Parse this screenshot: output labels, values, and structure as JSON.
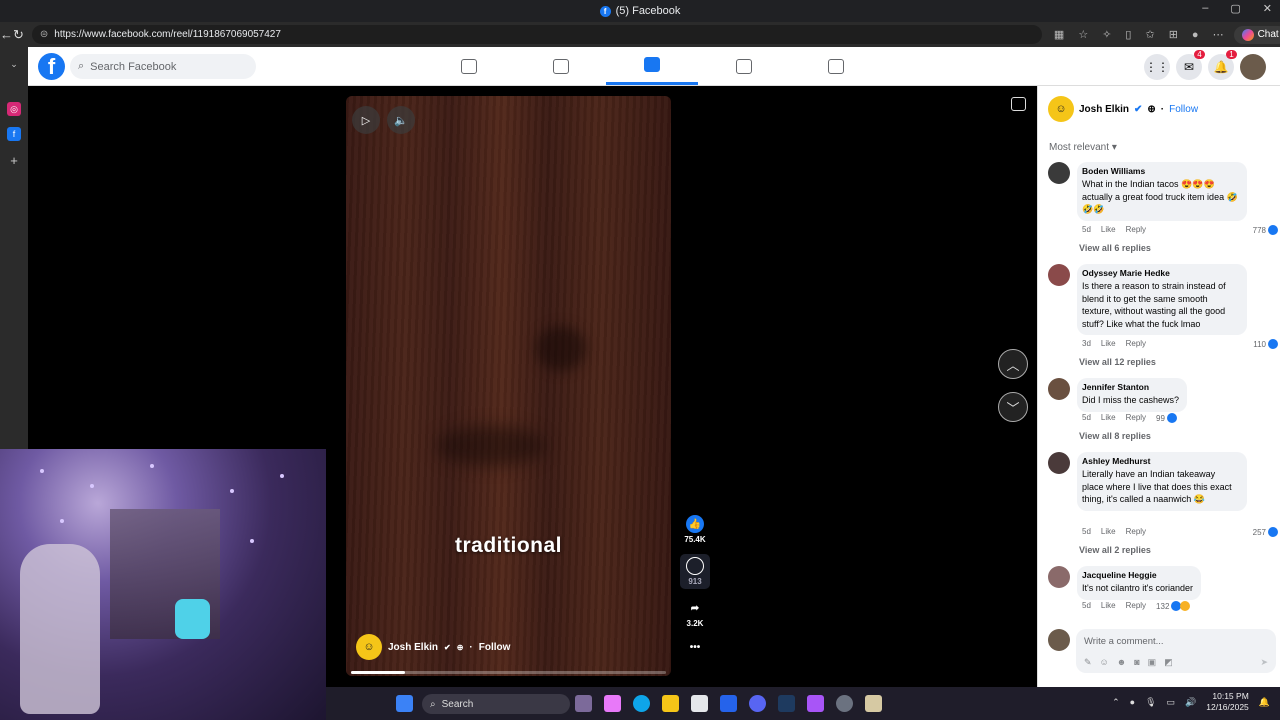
{
  "window": {
    "title": "(5) Facebook"
  },
  "browser": {
    "url": "https://www.facebook.com/reel/1191867069057427",
    "chat_label": "Chat"
  },
  "header": {
    "search_placeholder": "Search Facebook",
    "badges": {
      "messenger": "4",
      "notifications": "1"
    }
  },
  "reel": {
    "caption": "traditional",
    "author": "Josh Elkin",
    "follow_label": "Follow",
    "separator": "·",
    "likes": "75.4K",
    "comments": "913",
    "shares": "3.2K",
    "progress": 0.17
  },
  "panel": {
    "author": "Josh Elkin",
    "follow_label": "Follow",
    "sort_label": "Most relevant",
    "comments": [
      {
        "name": "Boden Williams",
        "text": "What in the Indian tacos 😍😍😍 actually a great food truck item idea 🤣🤣🤣",
        "time": "5d",
        "like": "Like",
        "reply": "Reply",
        "count": "778",
        "more": "View all 6 replies"
      },
      {
        "name": "Odyssey Marie Hedke",
        "text": "Is there a reason to strain instead of blend it to get the same smooth texture, without wasting all the good stuff? Like what the fuck lmao",
        "time": "3d",
        "like": "Like",
        "reply": "Reply",
        "count": "110",
        "more": "View all 12 replies"
      },
      {
        "name": "Jennifer Stanton",
        "text": "Did I miss the cashews?",
        "time": "5d",
        "like": "Like",
        "reply": "Reply",
        "count": "99",
        "more": "View all 8 replies"
      },
      {
        "name": "Ashley Medhurst",
        "text": "Literally have an Indian takeaway place where I live that does this exact thing, it's called a naanwich 😂",
        "time": "5d",
        "like": "Like",
        "reply": "Reply",
        "count": "257",
        "more": "View all 2 replies"
      },
      {
        "name": "Jacqueline Heggie",
        "text": "It's not cilantro it's coriander",
        "time": "5d",
        "like": "Like",
        "reply": "Reply",
        "count": "132",
        "more": ""
      }
    ],
    "write_placeholder": "Write a comment..."
  },
  "taskbar": {
    "search_label": "Search",
    "time": "10:15 PM",
    "date": "12/16/2025"
  },
  "colors": {
    "brand": "#1877f2",
    "panel_bg": "#ffffff",
    "bubble": "#f0f2f5"
  }
}
